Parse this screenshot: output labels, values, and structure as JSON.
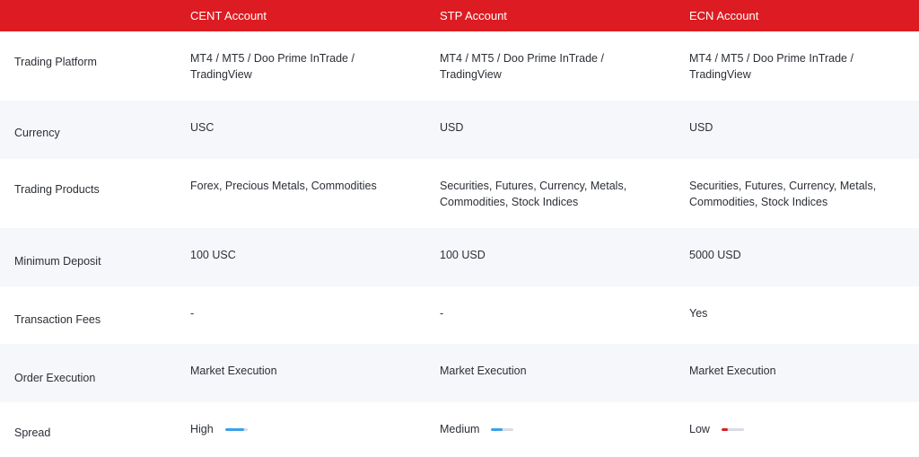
{
  "header": {
    "columns": [
      "",
      "CENT Account",
      "STP Account",
      "ECN Account"
    ]
  },
  "rows": [
    {
      "label": "Trading Platform",
      "values": [
        "MT4 / MT5 / Doo Prime InTrade / TradingView",
        "MT4 / MT5 / Doo Prime InTrade / TradingView",
        "MT4 / MT5 / Doo Prime InTrade / TradingView"
      ]
    },
    {
      "label": "Currency",
      "values": [
        "USC",
        "USD",
        "USD"
      ]
    },
    {
      "label": "Trading Products",
      "values": [
        "Forex, Precious Metals, Commodities",
        "Securities, Futures, Currency, Metals, Commodities, Stock Indices",
        "Securities, Futures, Currency, Metals, Commodities, Stock Indices"
      ]
    },
    {
      "label": "Minimum Deposit",
      "values": [
        "100 USC",
        "100 USD",
        "5000 USD"
      ]
    },
    {
      "label": "Transaction Fees",
      "values": [
        "-",
        "-",
        "Yes"
      ]
    },
    {
      "label": "Order Execution",
      "values": [
        "Market Execution",
        "Market Execution",
        "Market Execution"
      ]
    }
  ],
  "spread": {
    "label": "Spread",
    "items": [
      {
        "text": "High",
        "level": 0.85,
        "color": "#3aa0e8"
      },
      {
        "text": "Medium",
        "level": 0.5,
        "color": "#3aa0e8"
      },
      {
        "text": "Low",
        "level": 0.3,
        "color": "#dc1c22"
      }
    ]
  },
  "colors": {
    "header_bg": "#dc1c22",
    "alt_row_bg": "#f6f7fb",
    "bar_track": "#d9dce3"
  }
}
